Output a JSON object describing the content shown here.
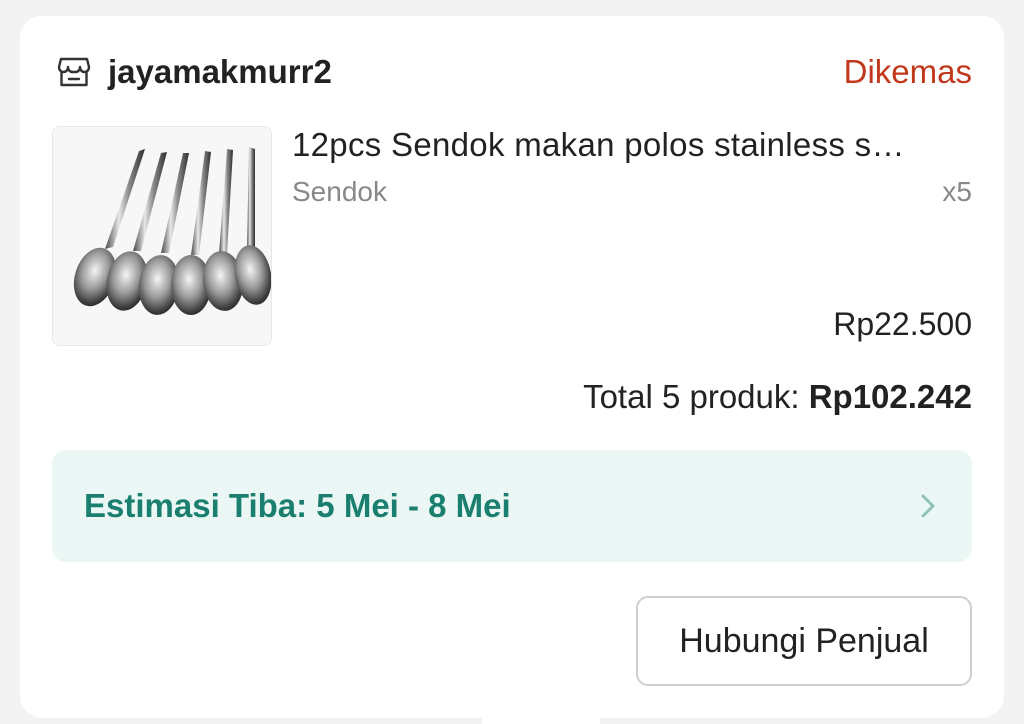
{
  "shop": {
    "name": "jayamakmurr2",
    "icon": "store-icon",
    "status": "Dikemas"
  },
  "product": {
    "title": "12pcs Sendok makan polos  stainless s…",
    "variant": "Sendok",
    "quantity": "x5",
    "price": "Rp22.500",
    "image": "spoons-product-image"
  },
  "total": {
    "label": "Total 5 produk:",
    "amount": "Rp102.242"
  },
  "delivery": {
    "estimate": "Estimasi Tiba: 5 Mei - 8 Mei",
    "icon": "chevron-right-icon"
  },
  "actions": {
    "contact_label": "Hubungi Penjual"
  },
  "colors": {
    "status": "#c2381c",
    "eta_text": "#1a7f6f",
    "eta_background": "#eaf7f4"
  }
}
